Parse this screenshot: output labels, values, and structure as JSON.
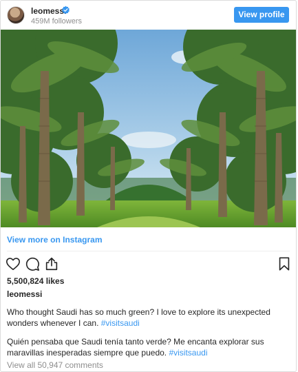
{
  "header": {
    "username": "leomessi",
    "followers": "459M followers",
    "view_profile_label": "View profile"
  },
  "icons": {
    "verified": "verified-badge-icon",
    "like": "heart-icon",
    "comment": "comment-icon",
    "share": "share-icon",
    "save": "bookmark-icon"
  },
  "post": {
    "view_more": "View more on Instagram",
    "likes": "5,500,824 likes",
    "username": "leomessi",
    "caption_en_text": "Who thought Saudi has so much green? I love to explore its unexpected wonders whenever I can. ",
    "caption_en_tag": "#visitsaudi",
    "caption_es_text": "Quién pensaba que Saudi tenía tanto verde? Me encanta explorar sus maravillas inesperadas siempre que puedo. ",
    "caption_es_tag": "#visitsaudi",
    "comments": "View all 50,947 comments"
  },
  "colors": {
    "accent": "#3897f0",
    "text": "#262626",
    "muted": "#8e8e8e"
  }
}
